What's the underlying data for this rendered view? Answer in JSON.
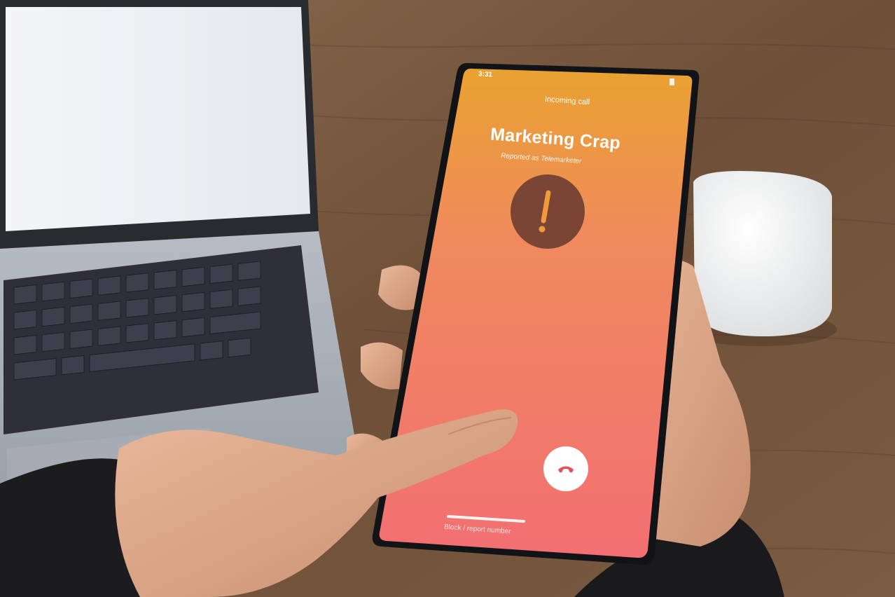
{
  "phone_screen": {
    "status_time": "3:31",
    "header": "Incoming call",
    "caller_name": "Marketing Crap",
    "caller_subtitle": "Reported as Telemarketer",
    "warning_glyph": "!",
    "bottom_action": "Block / report number"
  },
  "icons": {
    "warning": "exclamation-icon",
    "decline": "phone-hangup-icon"
  },
  "colors": {
    "screen_top": "#e9a230",
    "screen_mid": "#f08a5d",
    "screen_bottom": "#f26f73",
    "decline_icon": "#e4505a",
    "warning_circle": "#7a4534",
    "warning_glyph": "#f2993a"
  }
}
